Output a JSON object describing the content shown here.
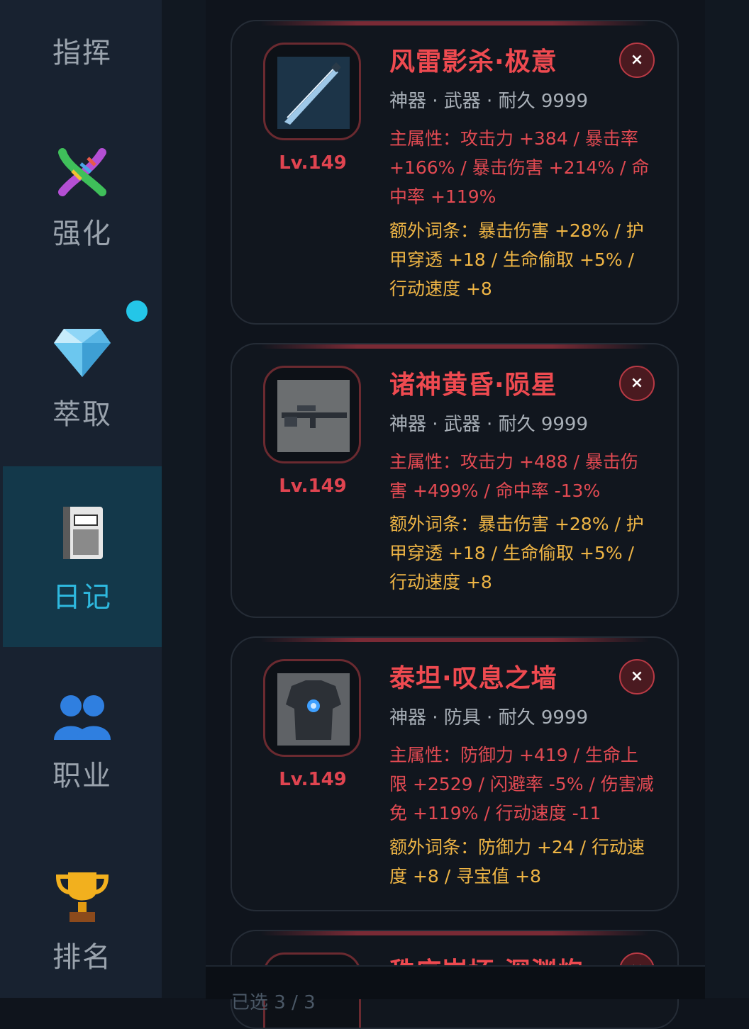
{
  "sidebar": {
    "items": [
      {
        "label": "指挥",
        "icon": "building-icon"
      },
      {
        "label": "强化",
        "icon": "dna-icon"
      },
      {
        "label": "萃取",
        "icon": "gem-icon",
        "has_notification": true
      },
      {
        "label": "日记",
        "icon": "notebook-icon",
        "active": true
      },
      {
        "label": "职业",
        "icon": "people-icon"
      },
      {
        "label": "排名",
        "icon": "trophy-icon"
      }
    ]
  },
  "cards": [
    {
      "name": "风雷影杀·极意",
      "meta": "神器 · 武器 · 耐久 9999",
      "level": "Lv.149",
      "icon": "blade-icon",
      "main_stat": "主属性：攻击力 +384 / 暴击率 +166% / 暴击伤害 +214% / 命中率 +119%",
      "extra_stat": "额外词条：暴击伤害 +28% / 护甲穿透 +18 / 生命偷取 +5% / 行动速度 +8",
      "close": "×"
    },
    {
      "name": "诸神黄昏·陨星",
      "meta": "神器 · 武器 · 耐久 9999",
      "level": "Lv.149",
      "icon": "sniper-rifle-icon",
      "main_stat": "主属性：攻击力 +488 / 暴击伤害 +499% / 命中率 -13%",
      "extra_stat": "额外词条：暴击伤害 +28% / 护甲穿透 +18 / 生命偷取 +5% / 行动速度 +8",
      "close": "×"
    },
    {
      "name": "泰坦·叹息之墙",
      "meta": "神器 · 防具 · 耐久 9999",
      "level": "Lv.149",
      "icon": "armor-icon",
      "main_stat": "主属性：防御力 +419 / 生命上限 +2529 / 闪避率 -5% / 伤害减免 +119% / 行动速度 -11",
      "extra_stat": "额外词条：防御力 +24 / 行动速度 +8 / 寻宝值 +8",
      "close": "×"
    },
    {
      "name": "秩序崩坏·深渊炮",
      "level": "",
      "close": "×"
    }
  ],
  "footer": {
    "selected_label": "已选 3 / 3"
  },
  "colors": {
    "accent_blue": "#2eb8de",
    "item_name_red": "#ef4a50",
    "main_stat_red": "#e24a52",
    "extra_stat_gold": "#efb545"
  }
}
